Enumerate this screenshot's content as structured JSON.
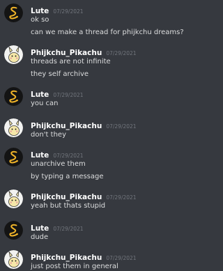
{
  "messages": [
    {
      "author": "Lute",
      "avatar": "lute-avatar",
      "timestamp": "07/29/2021",
      "lines": [
        "ok so",
        "can we make a thread for phijkchu dreams?"
      ]
    },
    {
      "author": "Phijkchu_Pikachu",
      "avatar": "phijkchu-avatar",
      "timestamp": "07/29/2021",
      "lines": [
        "threads are not infinite",
        "they self archive"
      ]
    },
    {
      "author": "Lute",
      "avatar": "lute-avatar",
      "timestamp": "07/29/2021",
      "lines": [
        "you can"
      ]
    },
    {
      "author": "Phijkchu_Pikachu",
      "avatar": "phijkchu-avatar",
      "timestamp": "07/29/2021",
      "lines": [
        "don't they"
      ]
    },
    {
      "author": "Lute",
      "avatar": "lute-avatar",
      "timestamp": "07/29/2021",
      "lines": [
        "unarchive them",
        "by typing a message"
      ]
    },
    {
      "author": "Phijkchu_Pikachu",
      "avatar": "phijkchu-avatar",
      "timestamp": "07/29/2021",
      "lines": [
        "yeah but thats stupid"
      ]
    },
    {
      "author": "Lute",
      "avatar": "lute-avatar",
      "timestamp": "07/29/2021",
      "lines": [
        "dude"
      ]
    },
    {
      "author": "Phijkchu_Pikachu",
      "avatar": "phijkchu-avatar",
      "timestamp": "07/29/2021",
      "lines": [
        "just post them in general"
      ]
    }
  ],
  "colors": {
    "background": "#36393f",
    "author": "#ffffff",
    "timestamp": "#72767d",
    "message_text": "#dcddde",
    "lute_avatar_bg": "#141414",
    "lute_avatar_symbol": "#f0b429",
    "phijkchu_avatar_bg": "#f2f2f0"
  }
}
